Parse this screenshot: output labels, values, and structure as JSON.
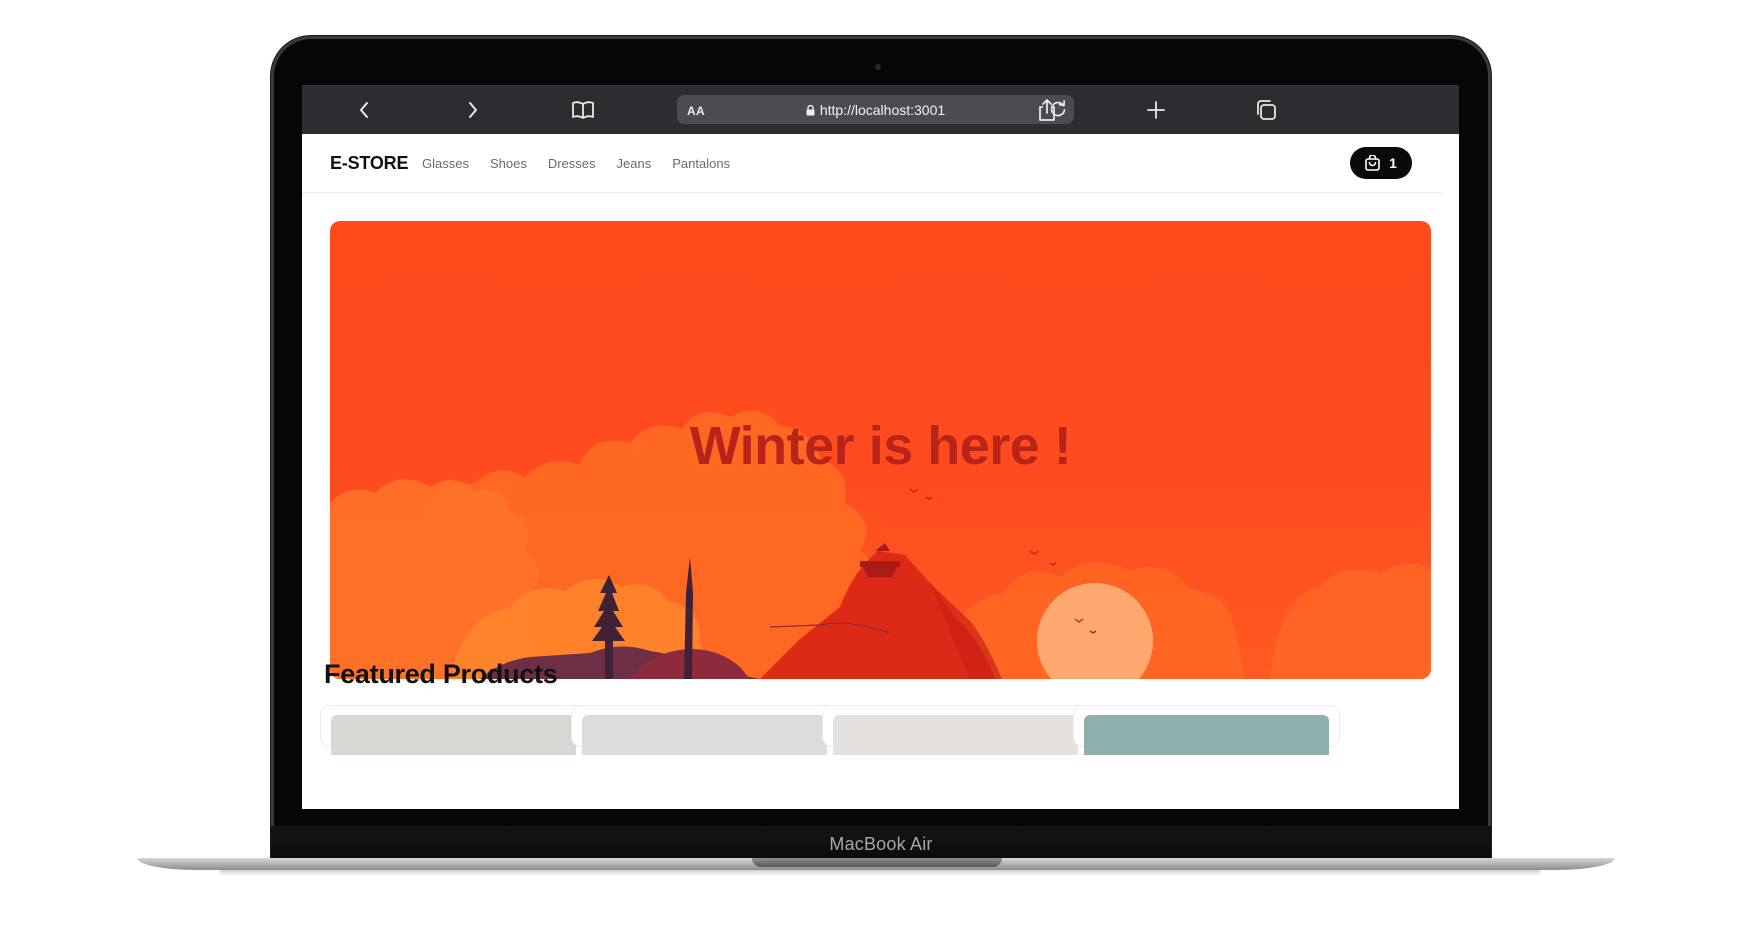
{
  "device": {
    "label": "MacBook Air"
  },
  "browser": {
    "text_size_label": "AA",
    "url": "http://localhost:3001",
    "buttons": [
      "back",
      "forward",
      "bookmarks",
      "share",
      "new-tab",
      "tabs"
    ]
  },
  "store": {
    "brand": "E-STORE",
    "nav": [
      "Glasses",
      "Shoes",
      "Dresses",
      "Jeans",
      "Pantalons"
    ],
    "cart_count": "1"
  },
  "hero": {
    "title": "Winter is here !",
    "background_color": "#ff4a1c",
    "title_color": "#b8241a"
  },
  "featured": {
    "title": "Featured Products",
    "cards": [
      {
        "thumb_color": "#d9d7d4"
      },
      {
        "thumb_color": "#dcdcdc"
      },
      {
        "thumb_color": "#e4e1de"
      },
      {
        "thumb_color": "#8fb1ae"
      }
    ]
  },
  "colors": {
    "toolbar": "#2b2d31",
    "cart": "#0a0a0a"
  }
}
